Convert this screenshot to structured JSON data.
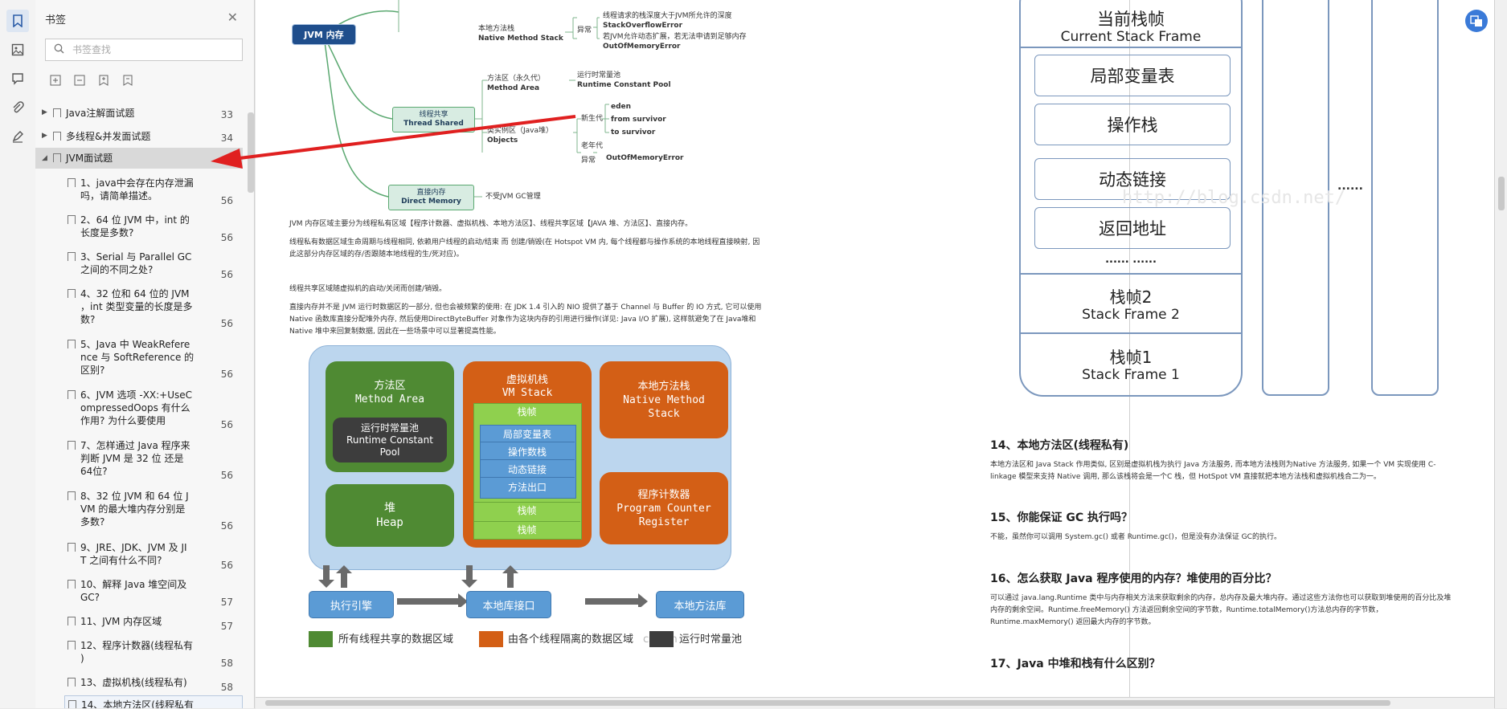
{
  "sidebar": {
    "title": "书签",
    "search_placeholder": "书签查找",
    "items": [
      {
        "label": "Java注解面试题",
        "page": "33"
      },
      {
        "label": "多线程&并发面试题",
        "page": "34"
      },
      {
        "label": "JVM面试题",
        "page": "56"
      },
      {
        "label": "1、java中会存在内存泄漏吗，请简单描述。",
        "lines": [
          "1、java中会存在内存泄漏",
          "吗，请简单描述。"
        ],
        "page": "56"
      },
      {
        "label": "2、64 位 JVM 中，int 的长度是多数？",
        "lines": [
          "2、64 位 JVM 中，int 的",
          "长度是多数?"
        ],
        "page": "56"
      },
      {
        "label": "3、Serial 与 Parallel GC之间的不同之处？",
        "lines": [
          "3、Serial 与 Parallel GC",
          "之间的不同之处?"
        ],
        "page": "56"
      },
      {
        "label": "4、32 位和 64 位的 JVM，int 类型变量的长度是多数？",
        "lines": [
          "4、32 位和 64 位的 JVM",
          "，int 类型变量的长度是多",
          "数?"
        ],
        "page": "56"
      },
      {
        "label": "5、Java 中 WeakReference 与 SoftReference 的区别？",
        "lines": [
          "5、Java 中 WeakRefere",
          "nce 与 SoftReference 的",
          "区别?"
        ],
        "page": "56"
      },
      {
        "label": "6、JVM 选项 -XX:+UseCompressedOops 有什么作用？为什么要使用",
        "lines": [
          "6、JVM 选项 -XX:+UseC",
          "ompressedOops 有什么",
          "作用? 为什么要使用"
        ],
        "page": "56"
      },
      {
        "label": "7、怎样通过 Java 程序来判断 JVM 是 32 位 还是64位？",
        "lines": [
          "7、怎样通过 Java 程序来",
          "判断 JVM 是 32 位 还是",
          "64位?"
        ],
        "page": "56"
      },
      {
        "label": "8、32 位 JVM 和 64 位 JVM 的最大堆内存分别是多数？",
        "lines": [
          "8、32 位 JVM 和 64 位 J",
          "VM 的最大堆内存分别是",
          "多数?"
        ],
        "page": "56"
      },
      {
        "label": "9、JRE、JDK、JVM 及 JIT 之间有什么不同？",
        "lines": [
          "9、JRE、JDK、JVM 及 JI",
          "T 之间有什么不同?"
        ],
        "page": "56"
      },
      {
        "label": "10、解释 Java 堆空间及 GC?",
        "lines": [
          "10、解释 Java 堆空间及",
          "GC?"
        ],
        "page": "57"
      },
      {
        "label": "11、JVM 内存区域",
        "page": "57"
      },
      {
        "label": "12、程序计数器(线程私有)",
        "lines": [
          "12、程序计数器(线程私有",
          ")"
        ],
        "page": "58"
      },
      {
        "label": "13、虚拟机栈(线程私有)",
        "page": "58"
      },
      {
        "label": "14、本地方法区(线程私有",
        "page": ""
      }
    ]
  },
  "mindmap": {
    "root": "JVM 内存",
    "native_stack": [
      "本地方法栈",
      "Native Method Stack"
    ],
    "native_exception": "异常",
    "native_err1": [
      "线程请求的栈深度大于JVM所允许的深度",
      "StackOverflowError"
    ],
    "native_err2": [
      "若JVM允许动态扩展，若无法申请到足够内存",
      "OutOfMemoryError"
    ],
    "shared": [
      "线程共享",
      "Thread Shared"
    ],
    "method_area": [
      "方法区（永久代）",
      "Method Area"
    ],
    "runtime_pool": [
      "运行时常量池",
      "Runtime Constant Pool"
    ],
    "heap": [
      "类实例区（Java堆）",
      "Objects"
    ],
    "young": "新生代",
    "young_items": [
      "eden",
      "from survivor",
      "to survivor"
    ],
    "old": "老年代",
    "heap_exception": "异常",
    "heap_oom": "OutOfMemoryError",
    "direct": [
      "直接内存",
      "Direct Memory"
    ],
    "direct_note": "不受JVM GC管理"
  },
  "left_page": {
    "p1": "JVM 内存区域主要分为线程私有区域【程序计数器、虚拟机栈、本地方法区】、线程共享区域【JAVA 堆、方法区】、直接内存。",
    "p2": "线程私有数据区域生命周期与线程相同, 依赖用户线程的启动/结束 而 创建/销毁(在 Hotspot VM 内, 每个线程都与操作系统的本地线程直接映射, 因此这部分内存区域的存/否跟随本地线程的生/死对应)。",
    "p3": "线程共享区域随虚拟机的启动/关闭而创建/销毁。",
    "p4": "直接内存并不是 JVM 运行时数据区的一部分, 但也会被频繁的使用: 在 JDK 1.4 引入的 NIO 提供了基于 Channel 与 Buffer 的 IO 方式, 它可以使用 Native 函数库直接分配堆外内存, 然后使用DirectByteBuffer 对象作为这块内存的引用进行操作(详见: Java I/O 扩展), 这样就避免了在 Java堆和 Native 堆中来回复制数据, 因此在一些场景中可以显著提高性能。"
  },
  "diagram": {
    "method_area": [
      "方法区",
      "Method Area"
    ],
    "runtime_pool": [
      "运行时常量池",
      "Runtime Constant",
      "Pool"
    ],
    "heap": [
      "堆",
      "Heap"
    ],
    "vm_stack": [
      "虚拟机栈",
      "VM Stack"
    ],
    "frame": "栈帧",
    "frame_items": [
      "局部变量表",
      "操作数栈",
      "动态链接",
      "方法出口"
    ],
    "native_stack": [
      "本地方法栈",
      "Native Method",
      "Stack"
    ],
    "pc": [
      "程序计数器",
      "Program Counter",
      "Register"
    ],
    "exec_engine": "执行引擎",
    "native_iface": "本地库接口",
    "native_lib": "本地方法库",
    "legend": [
      "所有线程共享的数据区域",
      "由各个线程隔离的数据区域",
      "运行时常量池"
    ],
    "watermark": "csdn.n"
  },
  "stack_figure": {
    "current": [
      "当前栈帧",
      "Current Stack Frame"
    ],
    "items": [
      "局部变量表",
      "操作栈",
      "动态链接",
      "返回地址"
    ],
    "dots": "...... ......",
    "frame2": [
      "栈帧2",
      "Stack Frame 2"
    ],
    "frame1": [
      "栈帧1",
      "Stack Frame 1"
    ],
    "side_dots": "......",
    "watermark": "http://blog.csdn.net/"
  },
  "right_page": {
    "h14": "14、本地方法区(线程私有)",
    "p14": "本地方法区和 Java Stack 作用类似, 区别是虚拟机栈为执行 Java 方法服务, 而本地方法栈则为Native 方法服务, 如果一个 VM 实现使用 C-linkage 模型来支持 Native 调用, 那么该栈将会是一个C 栈，但 HotSpot VM 直接就把本地方法栈和虚拟机栈合二为一。",
    "h15": "15、你能保证 GC 执行吗？",
    "p15": "不能，虽然你可以调用 System.gc() 或者 Runtime.gc()，但是没有办法保证 GC的执行。",
    "h16": "16、怎么获取 Java 程序使用的内存？堆使用的百分比？",
    "p16": "可以通过 java.lang.Runtime 类中与内存相关方法来获取剩余的内存，总内存及最大堆内存。通过这些方法你也可以获取到堆使用的百分比及堆内存的剩余空间。Runtime.freeMemory() 方法返回剩余空间的字节数，Runtime.totalMemory()方法总内存的字节数，Runtime.maxMemory() 返回最大内存的字节数。",
    "h17": "17、Java 中堆和栈有什么区别？"
  },
  "colors": {
    "green": "#4f8a33",
    "orange": "#d35f16",
    "light_green": "#8fd04e",
    "blue_box": "#5b9bd5",
    "panel_bg": "#bcd6ee",
    "dark": "#3d3d3d",
    "arrow": "#e02020"
  }
}
